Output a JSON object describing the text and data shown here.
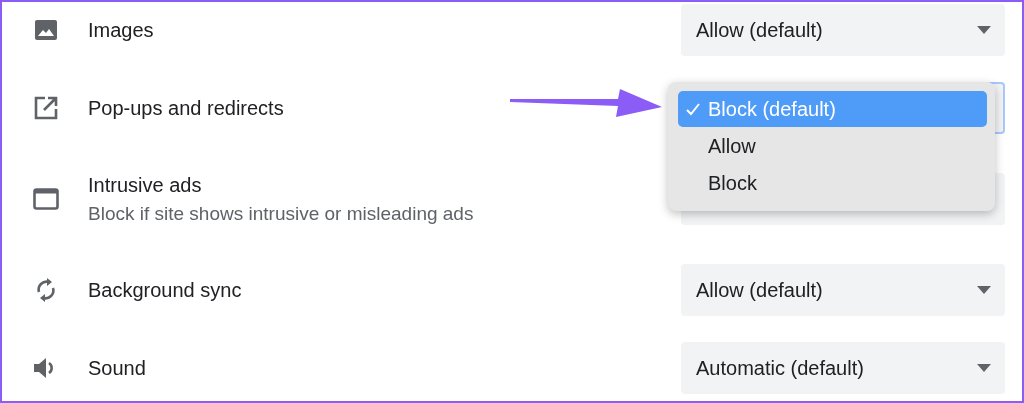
{
  "settings": [
    {
      "kind": "images",
      "label": "Images",
      "value": "Allow (default)",
      "focused": false
    },
    {
      "kind": "popup",
      "label": "Pop-ups and redirects",
      "focused": true,
      "menu": {
        "options": [
          {
            "label": "Block (default)",
            "selected": true
          },
          {
            "label": "Allow",
            "selected": false
          },
          {
            "label": "Block",
            "selected": false
          }
        ]
      }
    },
    {
      "kind": "ads",
      "label": "Intrusive ads",
      "description": "Block if site shows intrusive or misleading ads",
      "focused": false
    },
    {
      "kind": "sync",
      "label": "Background sync",
      "value": "Allow (default)",
      "focused": false
    },
    {
      "kind": "sound",
      "label": "Sound",
      "value": "Automatic (default)",
      "focused": false
    }
  ]
}
